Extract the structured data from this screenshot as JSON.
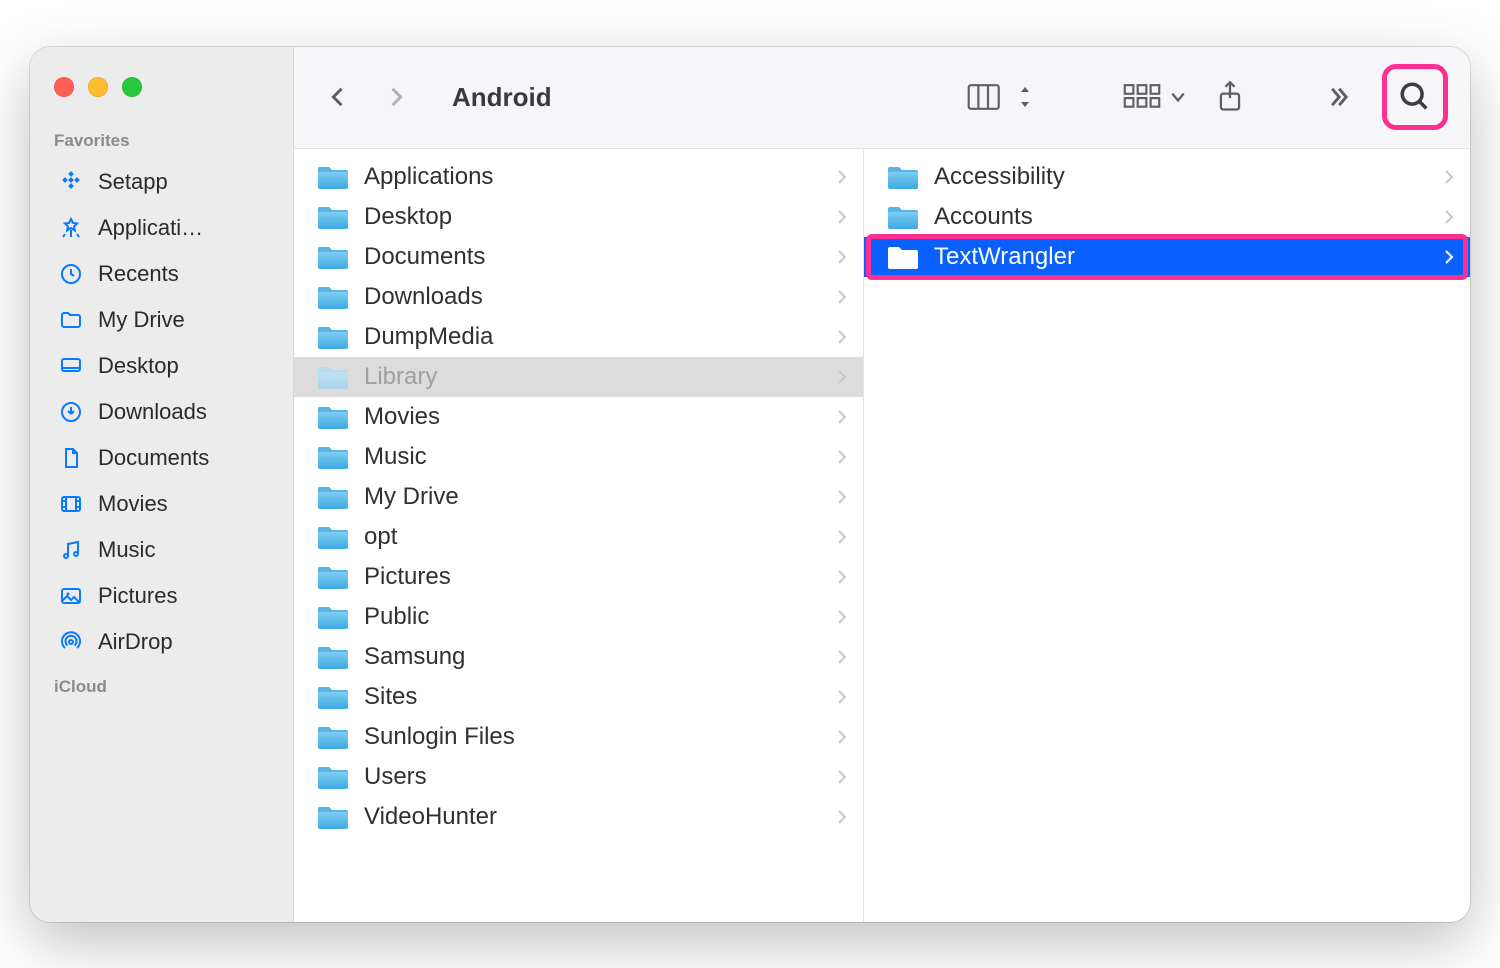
{
  "window": {
    "title": "Android"
  },
  "sidebar": {
    "sections": [
      {
        "label": "Favorites",
        "items": [
          {
            "icon": "setapp",
            "label": "Setapp"
          },
          {
            "icon": "appstore",
            "label": "Applicati…"
          },
          {
            "icon": "clock",
            "label": "Recents"
          },
          {
            "icon": "folder",
            "label": "My Drive"
          },
          {
            "icon": "desktop",
            "label": "Desktop"
          },
          {
            "icon": "download",
            "label": "Downloads"
          },
          {
            "icon": "doc",
            "label": "Documents"
          },
          {
            "icon": "movies",
            "label": "Movies"
          },
          {
            "icon": "music",
            "label": "Music"
          },
          {
            "icon": "pictures",
            "label": "Pictures"
          },
          {
            "icon": "airdrop",
            "label": "AirDrop"
          }
        ]
      },
      {
        "label": "iCloud",
        "items": []
      }
    ]
  },
  "toolbar": {
    "back": "‹",
    "forward": "›"
  },
  "columns": [
    {
      "items": [
        {
          "label": "Applications",
          "icon": "folder"
        },
        {
          "label": "Desktop",
          "icon": "folder"
        },
        {
          "label": "Documents",
          "icon": "folder"
        },
        {
          "label": "Downloads",
          "icon": "folder"
        },
        {
          "label": "DumpMedia",
          "icon": "folder"
        },
        {
          "label": "Library",
          "icon": "folder",
          "state": "inactive-selected"
        },
        {
          "label": "Movies",
          "icon": "folder"
        },
        {
          "label": "Music",
          "icon": "folder-music"
        },
        {
          "label": "My Drive",
          "icon": "folder-drive"
        },
        {
          "label": "opt",
          "icon": "folder"
        },
        {
          "label": "Pictures",
          "icon": "folder"
        },
        {
          "label": "Public",
          "icon": "folder-public"
        },
        {
          "label": "Samsung",
          "icon": "folder"
        },
        {
          "label": "Sites",
          "icon": "folder"
        },
        {
          "label": "Sunlogin Files",
          "icon": "folder"
        },
        {
          "label": "Users",
          "icon": "folder"
        },
        {
          "label": "VideoHunter",
          "icon": "folder"
        }
      ]
    },
    {
      "items": [
        {
          "label": "Accessibility",
          "icon": "folder"
        },
        {
          "label": "Accounts",
          "icon": "folder"
        },
        {
          "label": "TextWrangler",
          "icon": "folder",
          "state": "selected",
          "highlighted": true
        }
      ]
    }
  ]
}
